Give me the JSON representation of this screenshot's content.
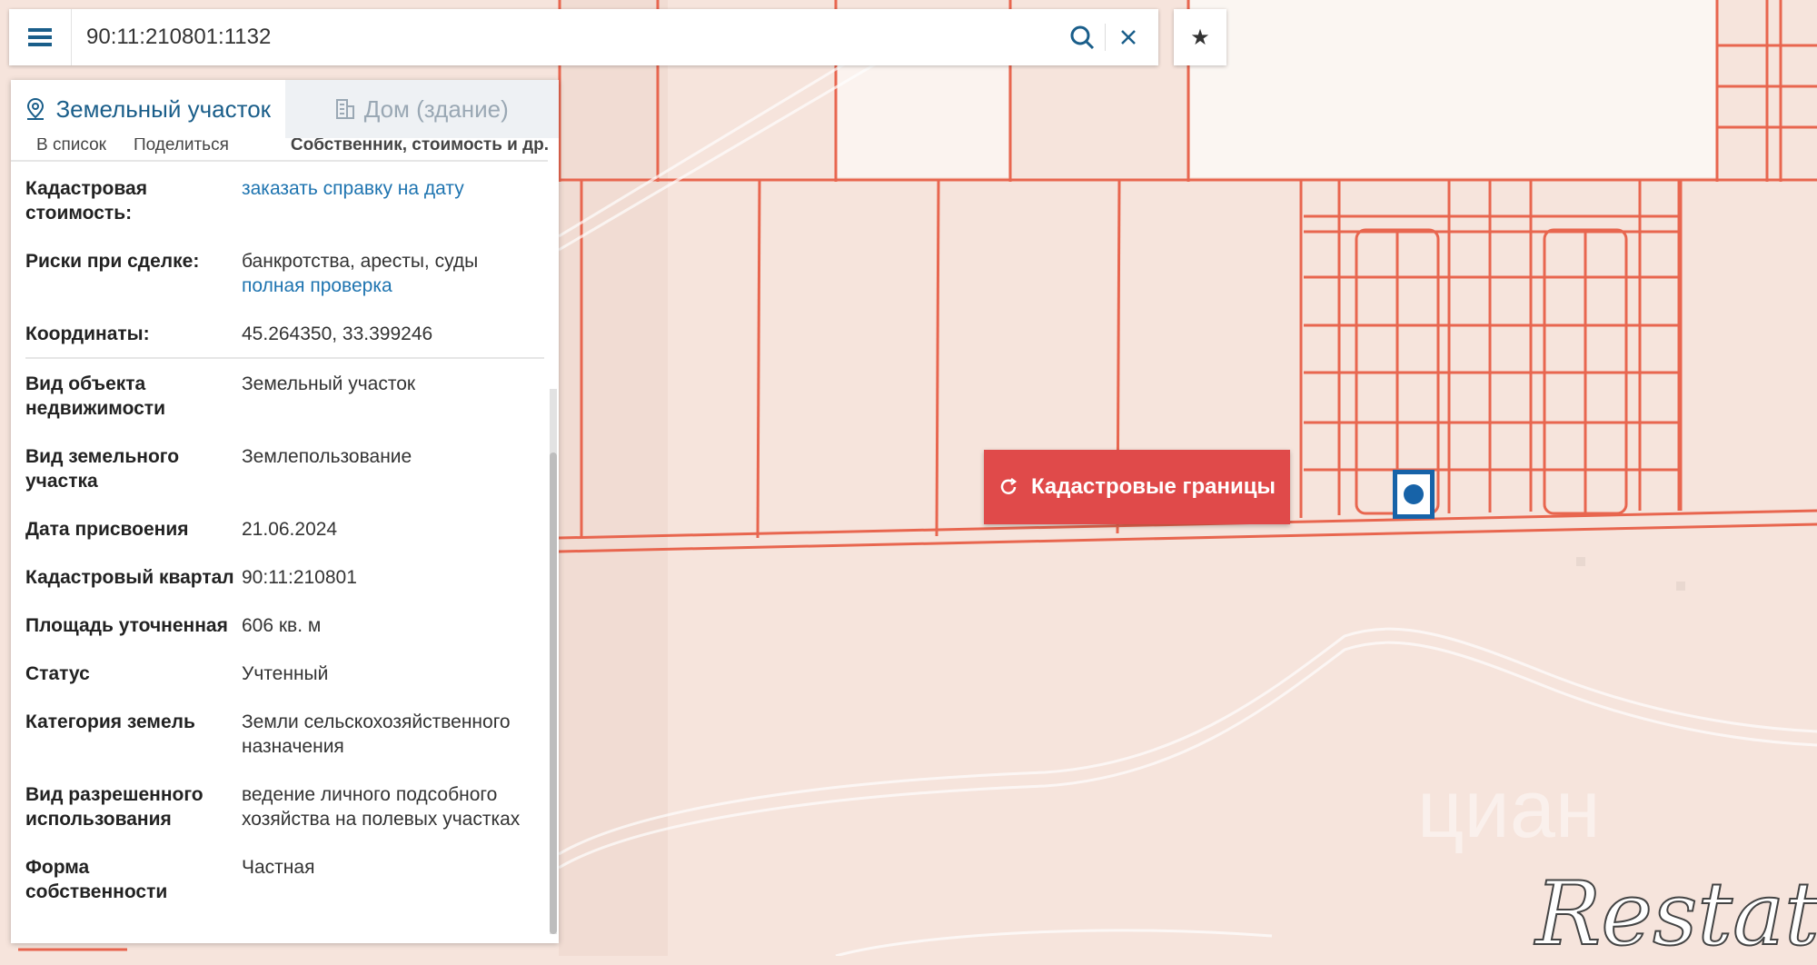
{
  "search": {
    "query": "90:11:210801:1132"
  },
  "panel": {
    "tabs": [
      {
        "label": "Земельный участок",
        "icon": "location-pin-icon"
      },
      {
        "label": "Дом (здание)",
        "icon": "building-icon"
      }
    ],
    "actions": {
      "to_list": "В список",
      "share": "Поделиться",
      "owner": "Собственник, стоимость и др."
    },
    "rows": {
      "cadastral_cost": {
        "label": "Кадастровая стоимость:",
        "link": "заказать справку на дату"
      },
      "risks": {
        "label": "Риски при сделке:",
        "value": "банкротства, аресты, суды",
        "link": "полная проверка"
      },
      "coords": {
        "label": "Координаты:",
        "value": "45.264350, 33.399246"
      },
      "object_type": {
        "label": "Вид объекта недвижимости",
        "value": "Земельный участок"
      },
      "land_type": {
        "label": "Вид земельного участка",
        "value": "Землепользование"
      },
      "date": {
        "label": "Дата присвоения",
        "value": "21.06.2024"
      },
      "quarter": {
        "label": "Кадастровый квартал",
        "value": "90:11:210801"
      },
      "area": {
        "label": "Площадь уточненная",
        "value": "606 кв. м"
      },
      "status": {
        "label": "Статус",
        "value": "Учтенный"
      },
      "category": {
        "label": "Категория земель",
        "value": "Земли сельскохозяйственного назначения"
      },
      "use": {
        "label": "Вид разрешенного использования",
        "value": "ведение личного подсобного хозяйства на полевых участках"
      },
      "ownership": {
        "label": "Форма собственности",
        "value": "Частная"
      }
    }
  },
  "map": {
    "boundaries_button": "Кадастровые границы"
  },
  "watermarks": {
    "cian": "циан",
    "restate": "Restate"
  },
  "colors": {
    "accent": "#1a5e8a",
    "link": "#1e74b0",
    "button": "#e04a4a",
    "parcel_line": "#e8664f",
    "parcel_fill": "#f6e4dc",
    "marker": "#1763a8"
  }
}
